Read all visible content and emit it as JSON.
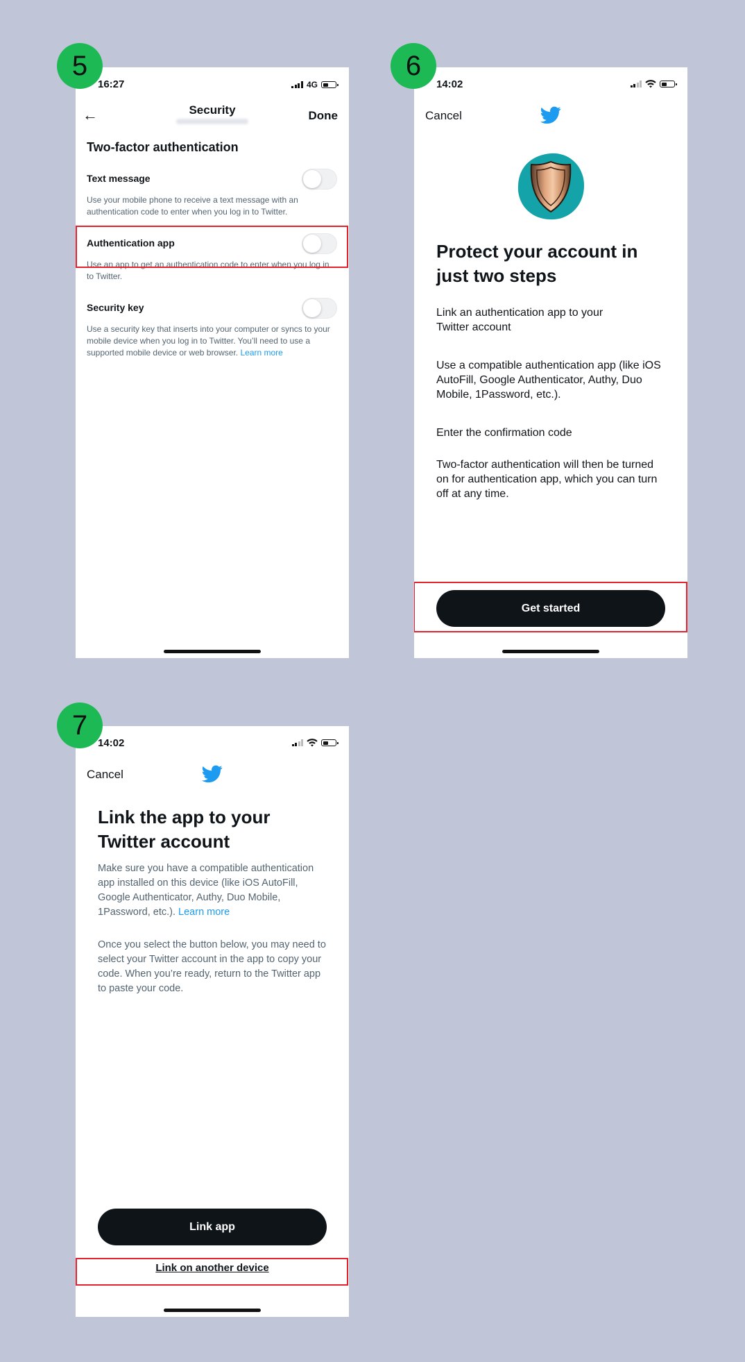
{
  "steps": [
    "5",
    "6",
    "7"
  ],
  "screen5": {
    "status": {
      "time": "16:27",
      "network": "4G"
    },
    "header": {
      "back": "←",
      "title": "Security",
      "done": "Done"
    },
    "section_title": "Two-factor authentication",
    "options": [
      {
        "title": "Text message",
        "desc": "Use your mobile phone to receive a text message with an authentication code to enter when you log in to Twitter."
      },
      {
        "title": "Authentication app",
        "desc": "Use an app to get an authentication code to enter when you log in to Twitter."
      },
      {
        "title": "Security key",
        "desc": "Use a security key that inserts into your computer or syncs to your mobile device when you log in to Twitter. You’ll need to use a supported mobile device or web browser.",
        "link": "Learn more"
      }
    ]
  },
  "screen6": {
    "status": {
      "time": "14:02"
    },
    "cancel": "Cancel",
    "title": "Protect your account in just two steps",
    "paragraphs": [
      "Link an authentication app to your Twitter account",
      "Use a compatible authentication app (like iOS AutoFill, Google Authenticator, Authy, Duo Mobile, 1Password, etc.).",
      "Enter the confirmation code",
      "Two-factor authentication will then be turned on for authentication app, which you can turn off at any time."
    ],
    "button": "Get started"
  },
  "screen7": {
    "status": {
      "time": "14:02"
    },
    "cancel": "Cancel",
    "title": "Link the app to your Twitter account",
    "para1": "Make sure you have a compatible authentication app installed on this device (like iOS AutoFill, Google Authenticator, Authy, Duo Mobile, 1Password, etc.).",
    "para1_link": "Learn more",
    "para2": "Once you select the button below, you may need to select your Twitter account in the app to copy your code. When you’re ready, return to the Twitter app to paste your code.",
    "button": "Link app",
    "alt_link": "Link on another device"
  },
  "colors": {
    "background": "#c0c6d8",
    "step_badge": "#1db954",
    "highlight": "#e4222b",
    "twitter_blue": "#1d9bf0",
    "button": "#0f1419"
  }
}
